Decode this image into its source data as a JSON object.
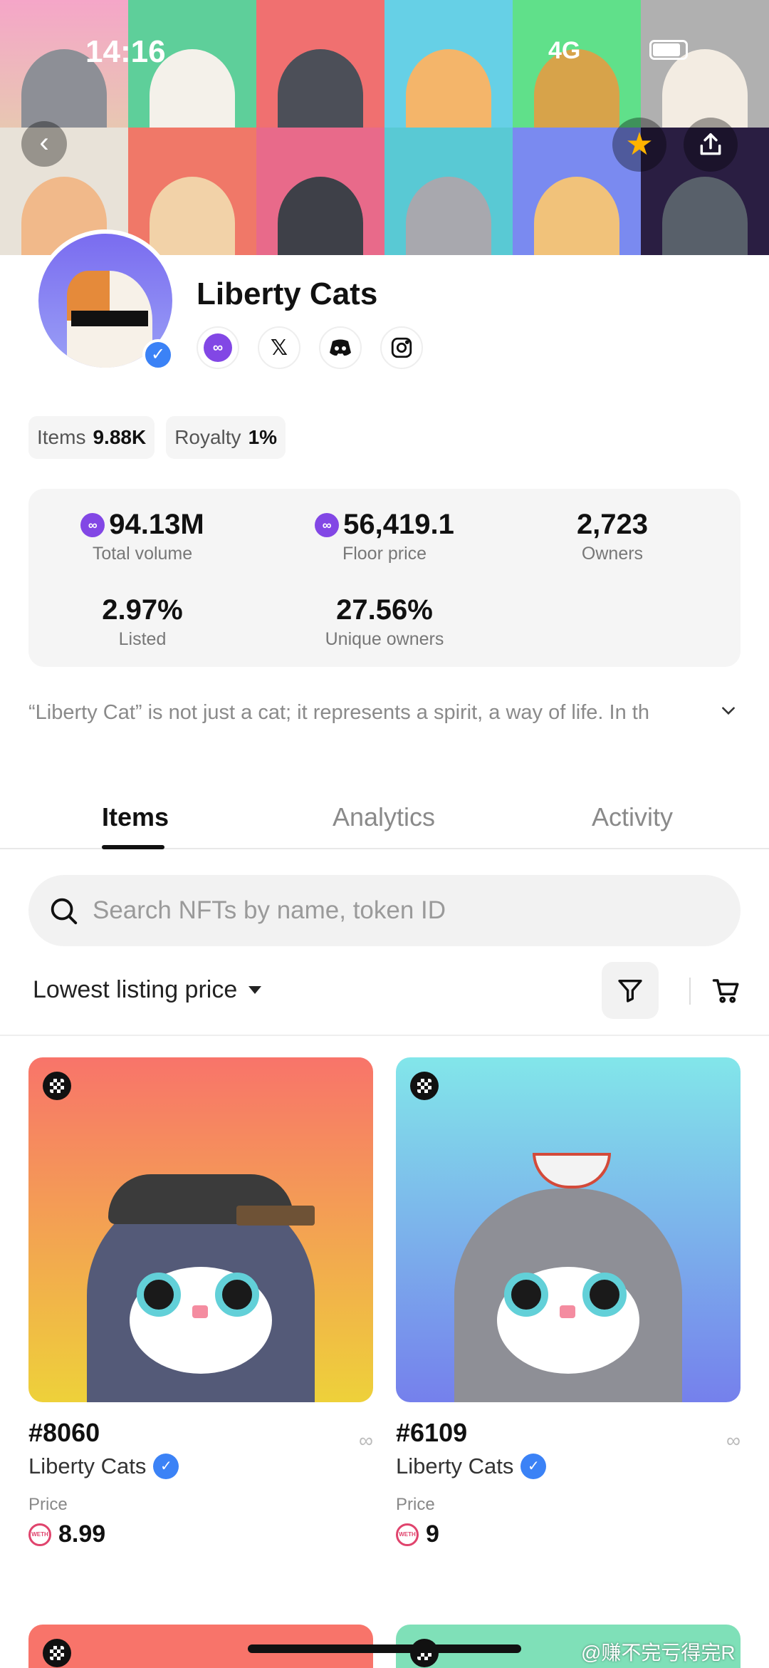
{
  "status_bar": {
    "time": "14:16",
    "network": "4G"
  },
  "collection": {
    "name": "Liberty Cats",
    "items_label": "Items",
    "items_value": "9.88K",
    "royalty_label": "Royalty",
    "royalty_value": "1%",
    "description": "“Liberty Cat” is not just a cat; it represents a spirit, a way of life. In th"
  },
  "stats": {
    "total_volume_value": "94.13M",
    "total_volume_label": "Total volume",
    "floor_price_value": "56,419.1",
    "floor_price_label": "Floor price",
    "owners_value": "2,723",
    "owners_label": "Owners",
    "listed_value": "2.97%",
    "listed_label": "Listed",
    "unique_owners_value": "27.56%",
    "unique_owners_label": "Unique owners"
  },
  "tabs": [
    {
      "label": "Items"
    },
    {
      "label": "Analytics"
    },
    {
      "label": "Activity"
    }
  ],
  "search": {
    "placeholder": "Search NFTs by name, token ID"
  },
  "sort": {
    "label": "Lowest listing price"
  },
  "cards": [
    {
      "number": "#8060",
      "collection": "Liberty Cats",
      "price_label": "Price",
      "price": "8.99",
      "bg_top": "#f8746a",
      "bg_bottom": "#eed13a",
      "body_color": "#545a78"
    },
    {
      "number": "#6109",
      "collection": "Liberty Cats",
      "price_label": "Price",
      "price": "9",
      "bg_top": "#82e6ea",
      "bg_bottom": "#7580ec",
      "body_color": "#8e8f96"
    }
  ],
  "watermark": "@赚不完亏得完R"
}
